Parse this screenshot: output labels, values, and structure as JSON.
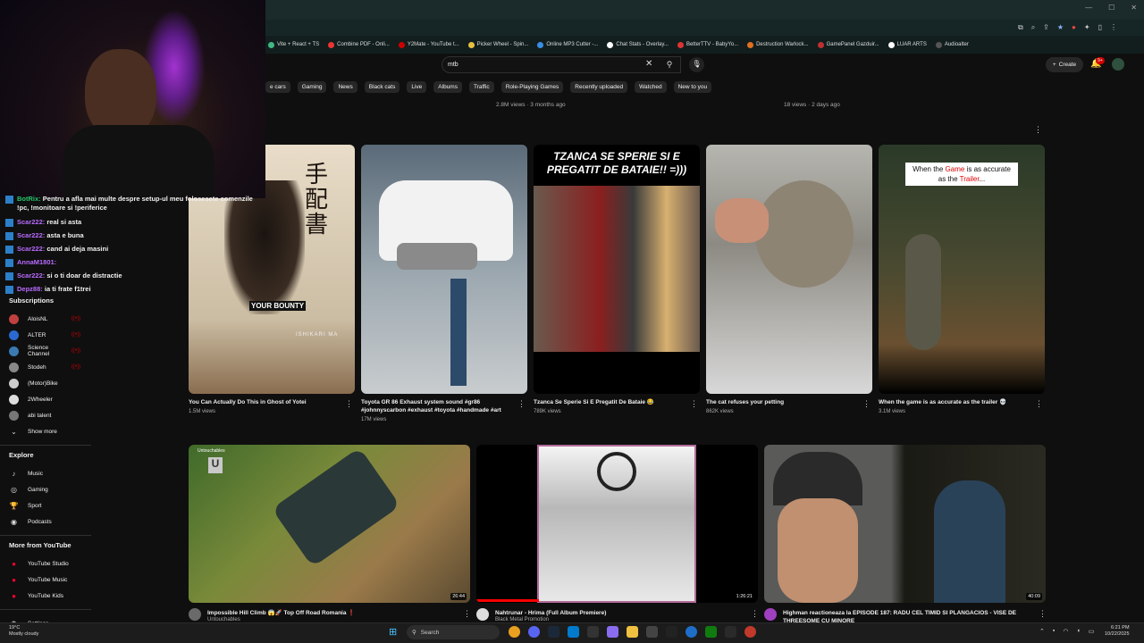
{
  "bookmarks": [
    "Vite + React + TS",
    "Combine PDF - Onli...",
    "Y2Mate - YouTube t...",
    "Picker Wheel - Spin...",
    "Online MP3 Cutter -...",
    "Chat Stats - Overlay...",
    "BetterTTV - BabyYo...",
    "Destruction Warlock...",
    "GamePanel Gazduir...",
    "LUAR ARTS",
    "Audioalter"
  ],
  "search": {
    "value": "mtb"
  },
  "header": {
    "create_label": "Create",
    "notif_count": "9+"
  },
  "chips": [
    "e cars",
    "Gaming",
    "News",
    "Black cats",
    "Live",
    "Albums",
    "Traffic",
    "Role-Playing Games",
    "Recently uploaded",
    "Watched",
    "New to you"
  ],
  "top_meta": {
    "left": "2.8M views · 3 months ago",
    "right": "18 views · 2 days ago"
  },
  "chat": [
    {
      "user": "BotRix:",
      "msg": "Pentru a afla mai multe despre setup-ul meu folosesete comenzile !pc, !monitoare si !periferice"
    },
    {
      "user": "Scar222:",
      "msg": "real si asta"
    },
    {
      "user": "Scar222:",
      "msg": "asta e buna"
    },
    {
      "user": "Scar222:",
      "msg": "cand ai deja masini"
    },
    {
      "user": "AnnaM1801:",
      "msg": ""
    },
    {
      "user": "Scar222:",
      "msg": "si o ti doar de distractie"
    },
    {
      "user": "Depz88:",
      "msg": "ia ti frate f1trei"
    }
  ],
  "sidebar": {
    "subscriptions_label": "Subscriptions",
    "channels": [
      "AloisNL",
      "ALTER",
      "Science Channel",
      "Stodeh",
      "(Motor)Bike",
      "2Wheeler",
      "abi talent"
    ],
    "show_more": "Show more",
    "explore_label": "Explore",
    "explore": [
      "Music",
      "Gaming",
      "Sport",
      "Podcasts"
    ],
    "more_label": "More from YouTube",
    "more": [
      "YouTube Studio",
      "YouTube Music",
      "YouTube Kids"
    ],
    "settings": "Settings"
  },
  "shorts": [
    {
      "title": "You Can Actually Do This in Ghost of Yotei",
      "views": "1.5M views",
      "overlay": "YOUR BOUNTY",
      "overlay2": "ISHIKARI MA"
    },
    {
      "title": "Toyota GR 86 Exhaust system sound #gr86 #johnnyscarbon #exhaust #toyota #handmade #art",
      "views": "17M views"
    },
    {
      "title": "Tzanca Se Sperie Si E Pregatit De Bataie 😂",
      "views": "789K views",
      "overlay": "TZANCA SE SPERIE SI E PREGATIT DE BATAIE!! =)))"
    },
    {
      "title": "The cat refuses your petting",
      "views": "862K views"
    },
    {
      "title": "When the game is as accurate as the trailer 💀",
      "views": "3.1M views",
      "overlay_pre": "When the ",
      "overlay_word1": "Game",
      "overlay_mid": " is as accurate as the ",
      "overlay_word2": "Trailer",
      "overlay_post": "..."
    }
  ],
  "videos": [
    {
      "title": "Impossible Hill Climb 😱🚀 Top Off Road Romania ❗",
      "channel": "Untouchables",
      "duration": "26:44",
      "badge": "Untouchables"
    },
    {
      "title": "Nahtrunar - Hrima (Full Album Premiere)",
      "channel": "Black Metal Promotion",
      "duration": "1:26:21"
    },
    {
      "title": "Highman reactioneaza la EPISODE 187: RADU CEL TIMID SI PLANGACIOS - VISE DE THREESOME CU MINORE",
      "channel": "",
      "duration": "40:09"
    }
  ],
  "taskbar": {
    "search_label": "Search",
    "weather_temp": "19°C",
    "weather_desc": "Mostly cloudy",
    "time": "6:21 PM",
    "date": "10/22/2025"
  }
}
